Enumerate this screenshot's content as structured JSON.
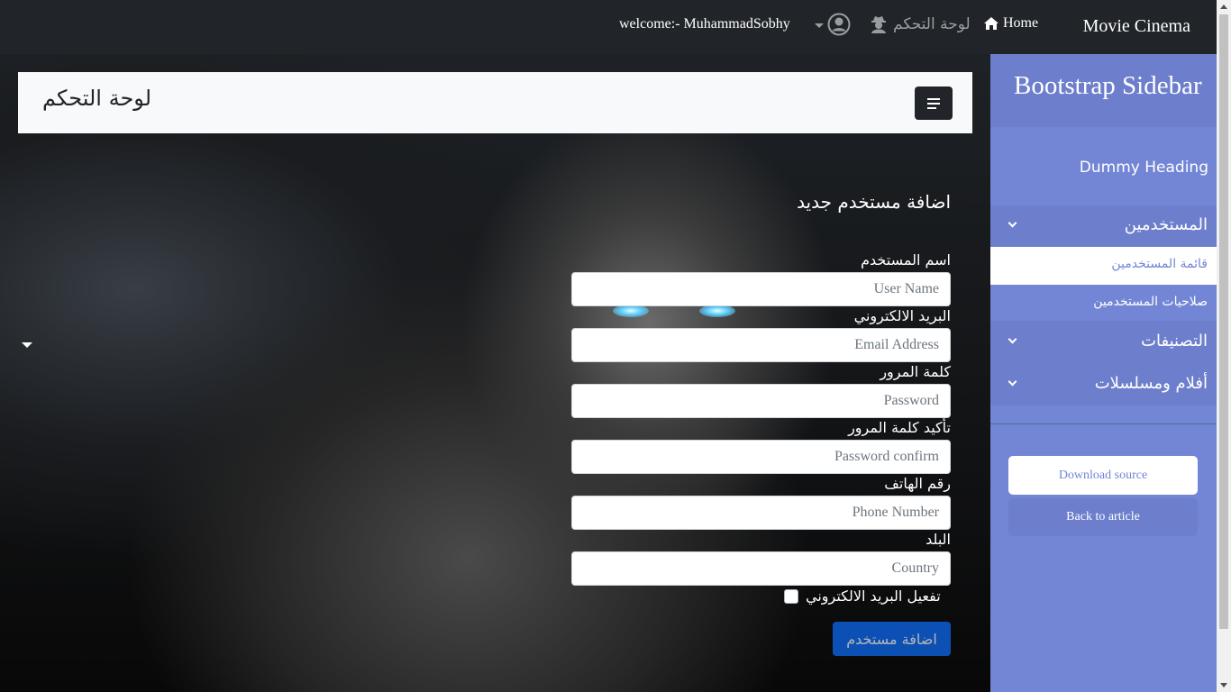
{
  "navbar": {
    "brand": "Movie Cinema",
    "home_label": "Home",
    "dashboard_label": "لوحة التحكم",
    "welcome": "welcome:- MuhammadSobhy"
  },
  "header": {
    "title": "لوحة التحكم"
  },
  "form": {
    "title": "اضافة مستخدم جديد",
    "fields": [
      {
        "label": "اسم المستخدم",
        "placeholder": "User Name"
      },
      {
        "label": "البريد الالكتروني",
        "placeholder": "Email Address"
      },
      {
        "label": "كلمة المرور",
        "placeholder": "Password"
      },
      {
        "label": "تأكيد كلمة المرور",
        "placeholder": "Password confirm"
      },
      {
        "label": "رقم الهاتف",
        "placeholder": "Phone Number"
      },
      {
        "label": "البلد",
        "placeholder": "Country"
      }
    ],
    "checkbox_label": "تفعيل البريد الالكتروني",
    "checkbox_checked": false,
    "submit_label": "اضافة مستخدم"
  },
  "sidebar": {
    "title": "Bootstrap Sidebar",
    "heading": "Dummy Heading",
    "groups": [
      {
        "label": "المستخدمين",
        "expanded": true
      },
      {
        "label": "التصنيفات",
        "expanded": false
      },
      {
        "label": "أفلام ومسلسلات",
        "expanded": false
      }
    ],
    "users_subitems": [
      {
        "label": "قائمة المستخدمين",
        "active": true
      },
      {
        "label": "صلاحيات المستخدمين",
        "active": false
      }
    ],
    "download_label": "Download source",
    "back_label": "Back to article"
  },
  "colors": {
    "navbar_bg": "#212529",
    "sidebar_bg": "#7386d5",
    "sidebar_dark": "#6d7fcc",
    "primary_button": "#0d6efd"
  }
}
